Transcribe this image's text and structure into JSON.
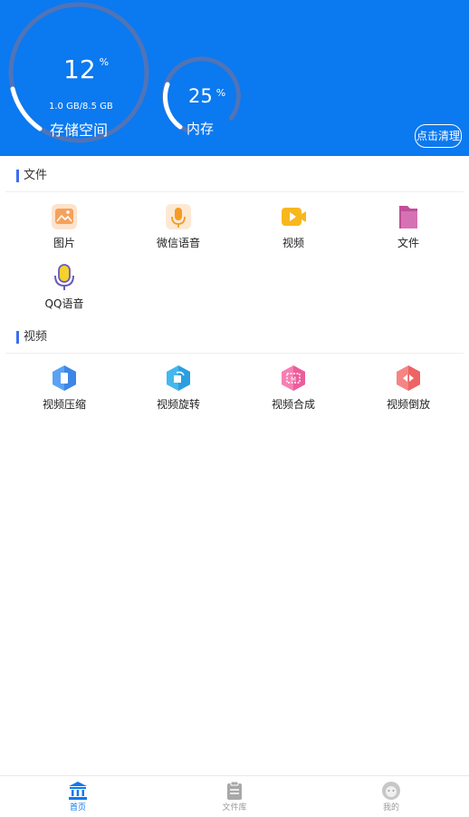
{
  "header": {
    "storage_percent": "12",
    "percent_sign": "%",
    "storage_size": "1.0 GB/8.5 GB",
    "storage_label": "存储空间",
    "storage_fraction": 0.12,
    "memory_percent": "25",
    "memory_label": "内存",
    "memory_fraction": 0.25,
    "clean_button": "点击清理",
    "bg_color": "#0b79f0"
  },
  "files_section": {
    "title": "文件",
    "items": [
      {
        "label": "图片",
        "icon": "image-icon"
      },
      {
        "label": "微信语音",
        "icon": "microphone-icon"
      },
      {
        "label": "视频",
        "icon": "video-icon"
      },
      {
        "label": "文件",
        "icon": "folder-icon"
      },
      {
        "label": "QQ语音",
        "icon": "qq-microphone-icon"
      }
    ]
  },
  "video_section": {
    "title": "视频",
    "items": [
      {
        "label": "视频压缩",
        "icon": "compress-icon"
      },
      {
        "label": "视频旋转",
        "icon": "rotate-icon"
      },
      {
        "label": "视频合成",
        "icon": "merge-icon"
      },
      {
        "label": "视频倒放",
        "icon": "reverse-icon"
      }
    ]
  },
  "tabbar": {
    "tabs": [
      {
        "label": "首页",
        "icon": "home-icon",
        "active": true
      },
      {
        "label": "文件库",
        "icon": "clipboard-icon",
        "active": false
      },
      {
        "label": "我的",
        "icon": "profile-icon",
        "active": false
      }
    ],
    "active_color": "#0b79f0",
    "inactive_color": "#999999"
  }
}
